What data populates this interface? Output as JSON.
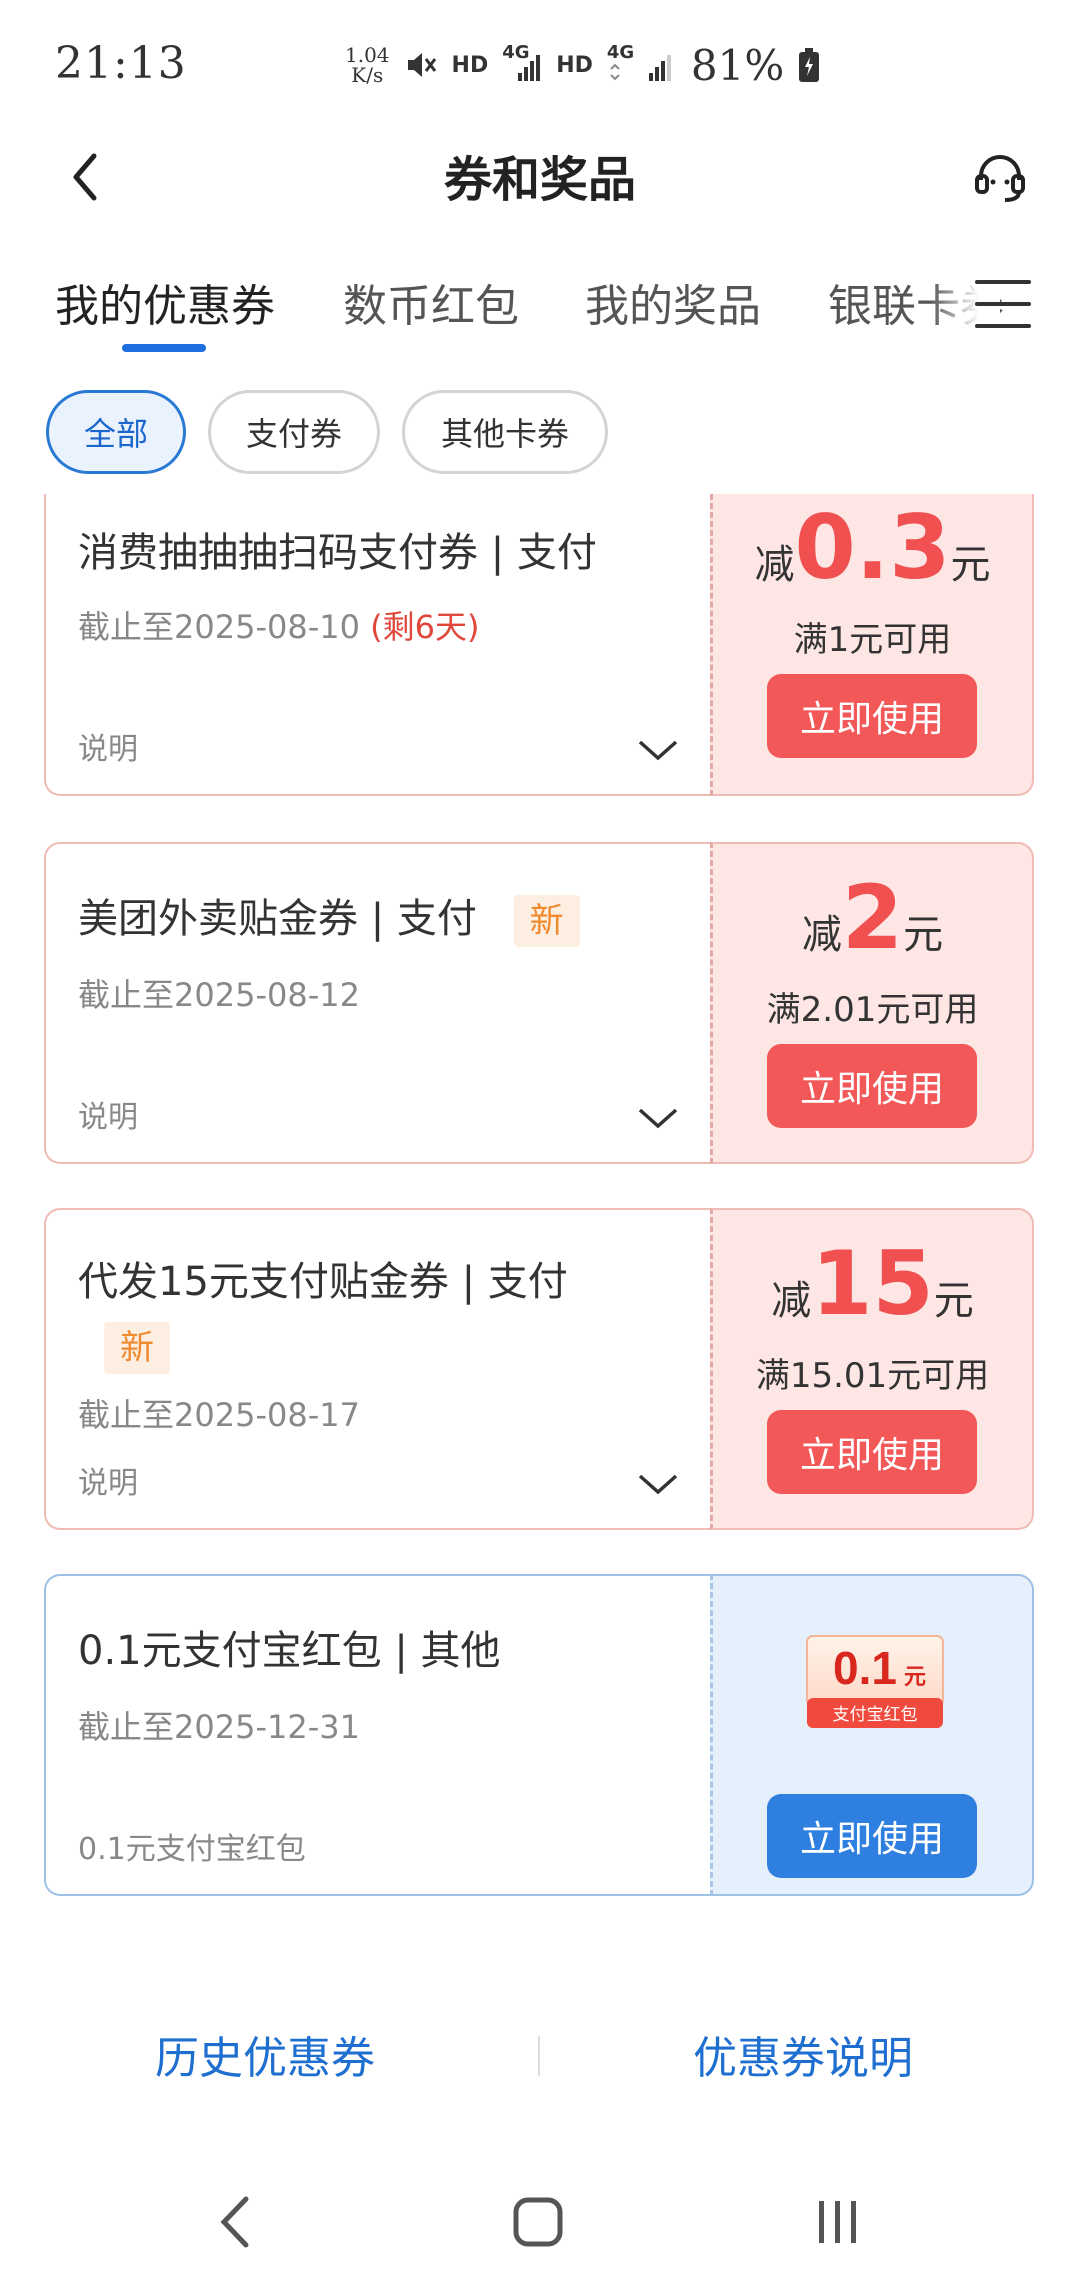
{
  "status_bar": {
    "time": "21:13",
    "speed_value": "1.04",
    "speed_unit": "K/s",
    "hd1": "HD",
    "net1": "4G",
    "hd2": "HD",
    "net2": "4G",
    "battery": "81%"
  },
  "header": {
    "title": "券和奖品"
  },
  "tabs": [
    {
      "label": "我的优惠券",
      "active": true
    },
    {
      "label": "数币红包"
    },
    {
      "label": "我的奖品"
    },
    {
      "label": "银联卡券"
    }
  ],
  "filters": [
    {
      "label": "全部",
      "active": true
    },
    {
      "label": "支付券"
    },
    {
      "label": "其他卡券"
    }
  ],
  "coupons": [
    {
      "title": "消费抽抽抽扫码支付券 | 支付",
      "expire": "截止至2025-08-10",
      "remain": "(剩6天)",
      "desc": "说明",
      "prefix": "减",
      "amount": "0.3",
      "unit": "元",
      "condition": "满1元可用",
      "button": "立即使用"
    },
    {
      "title": "美团外卖贴金券 | 支付",
      "badge": "新",
      "expire": "截止至2025-08-12",
      "desc": "说明",
      "prefix": "减",
      "amount": "2",
      "unit": "元",
      "condition": "满2.01元可用",
      "button": "立即使用"
    },
    {
      "title": "代发15元支付贴金券 | 支付",
      "badge": "新",
      "expire": "截止至2025-08-17",
      "desc": "说明",
      "prefix": "减",
      "amount": "15",
      "unit": "元",
      "condition": "满15.01元可用",
      "button": "立即使用"
    },
    {
      "title": "0.1元支付宝红包 | 其他",
      "expire": "截止至2025-12-31",
      "desc": "0.1元支付宝红包",
      "image_amount": "0.1",
      "image_unit": "元",
      "image_caption": "支付宝红包",
      "button": "立即使用"
    }
  ],
  "bottom_links": {
    "history": "历史优惠券",
    "explain": "优惠券说明"
  },
  "colors": {
    "accent_blue": "#1f6fe0",
    "coupon_red": "#f25858",
    "coupon_bg": "#fde6e4",
    "blue_coupon_bg": "#e6f0fc"
  }
}
